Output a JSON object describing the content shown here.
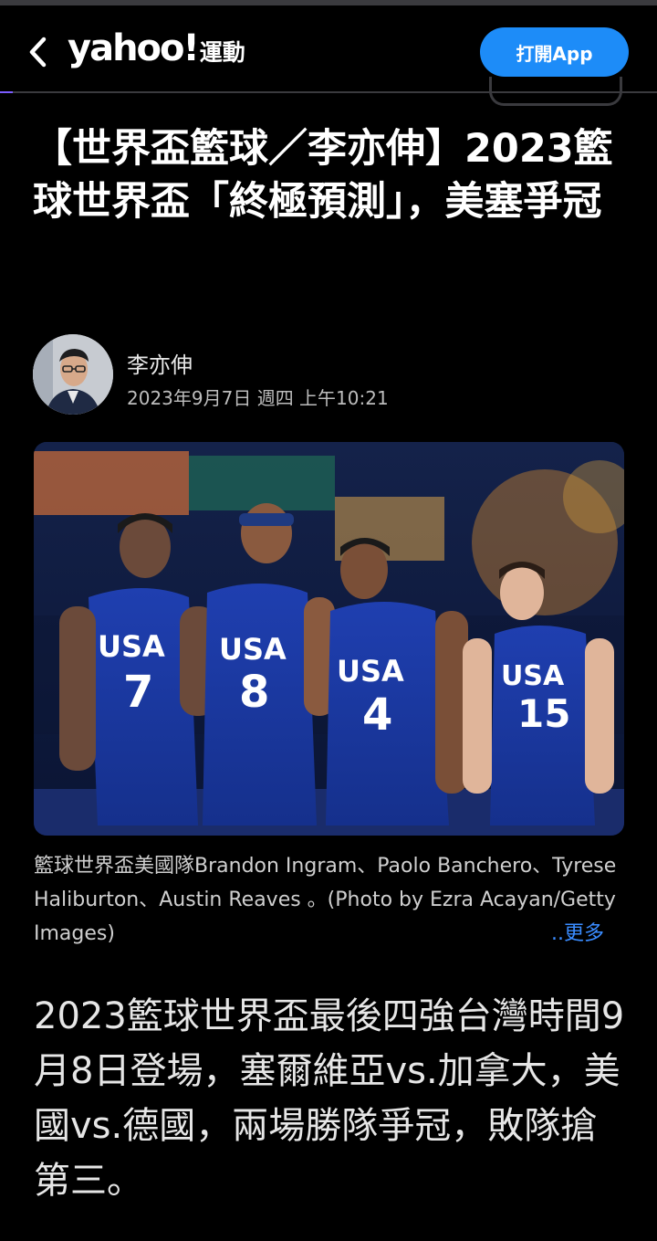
{
  "header": {
    "logo_text": "yahoo!",
    "logo_section": "運動",
    "open_app_label": "打開App",
    "reading_progress": 0.02
  },
  "article": {
    "title": "【世界盃籃球／李亦伸】2023籃球世界盃「終極預測」，美塞爭冠",
    "author": "李亦伸",
    "date": "2023年9月7日 週四 上午10:21",
    "image": {
      "jersey_text": "USA",
      "jersey_numbers": [
        "7",
        "8",
        "4",
        "15"
      ],
      "caption": "籃球世界盃美國隊Brandon Ingram、Paolo Banchero、Tyrese Haliburton、Austin Reaves 。(Photo by Ezra Acayan/Getty Images)",
      "more_label": "..更多"
    },
    "body": "2023籃球世界盃最後四強台灣時間9月8日登場，塞爾維亞vs.加拿大，美國vs.德國，兩場勝隊爭冠，敗隊搶第三。"
  },
  "colors": {
    "background": "#000000",
    "accent_blue": "#1d8cf8",
    "progress_purple": "#7b5cff",
    "link_blue": "#3a8cff"
  },
  "icons": {
    "back": "chevron-left-icon"
  }
}
